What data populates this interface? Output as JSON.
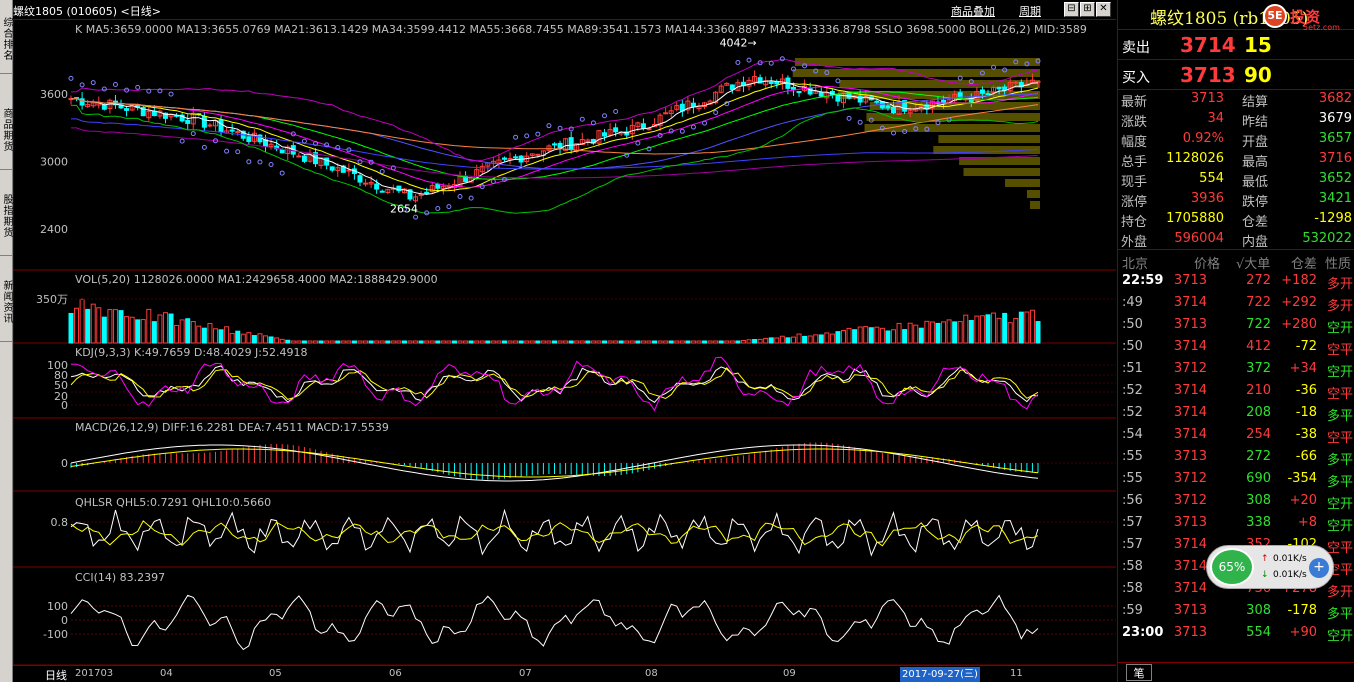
{
  "window": {
    "title": "螺纹1805 (010605) <日线>",
    "links": [
      "商品叠加",
      "周期"
    ],
    "nav_buttons": [
      "⊟",
      "⊞",
      "✕"
    ]
  },
  "left_tabs": [
    "综合排名",
    "商品期货",
    "股指期货",
    "新闻资讯"
  ],
  "indicators": {
    "main": "K  MA5:3659.0000  MA13:3655.0769  MA21:3613.1429  MA34:3599.4412  MA55:3668.7455  MA89:3541.1573  MA144:3360.8897  MA233:3336.8798  SSLO  3698.5000  BOLL(26,2)  MID:3589",
    "vol": "VOL(5,20)  1128026.0000  MA1:2429658.4000  MA2:1888429.9000",
    "kdj": "KDJ(9,3,3)  K:49.7659  D:48.4029  J:52.4918",
    "macd": "MACD(26,12,9)  DIFF:16.2281  DEA:7.4511  MACD:17.5539",
    "qhlsr": "QHLSR  QHL5:0.7291  QHL10:0.5660",
    "cci": "CCI(14)  83.2397"
  },
  "annotations": {
    "high": "4042→",
    "low": "2654"
  },
  "axis_labels": {
    "price": [
      "3600",
      "3000",
      "2400"
    ],
    "vol": [
      "350万"
    ],
    "kdj": [
      "100",
      "80",
      "50",
      "20",
      "0"
    ],
    "macd": [
      "0"
    ],
    "qhlsr": [
      "0.8"
    ],
    "cci": [
      "100",
      "0",
      "-100"
    ]
  },
  "date_axis": {
    "label": "日线",
    "ticks": [
      "201703",
      "04",
      "05",
      "06",
      "07",
      "08",
      "09",
      "11"
    ],
    "cursor": "2017-09-27(三)"
  },
  "quote": {
    "name": "螺纹1805 (rb1805)",
    "brand": "投资",
    "brand_sub": "5etz.com",
    "logo": "5E",
    "sell": {
      "label": "卖出",
      "price": "3714",
      "volume": "15"
    },
    "buy": {
      "label": "买入",
      "price": "3713",
      "volume": "90"
    },
    "stats": [
      {
        "l1": "最新",
        "v1": "3713",
        "c1": "#ff3b3b",
        "l2": "结算",
        "v2": "3682",
        "c2": "#ff3b3b"
      },
      {
        "l1": "涨跌",
        "v1": "34",
        "c1": "#ff3b3b",
        "l2": "昨结",
        "v2": "3679",
        "c2": "#ffffff"
      },
      {
        "l1": "幅度",
        "v1": "0.92%",
        "c1": "#ff3b3b",
        "l2": "开盘",
        "v2": "3657",
        "c2": "#2fe02f"
      },
      {
        "l1": "总手",
        "v1": "1128026",
        "c1": "#ffff00",
        "l2": "最高",
        "v2": "3716",
        "c2": "#ff3b3b"
      },
      {
        "l1": "现手",
        "v1": "554",
        "c1": "#ffff00",
        "l2": "最低",
        "v2": "3652",
        "c2": "#2fe02f"
      },
      {
        "l1": "涨停",
        "v1": "3936",
        "c1": "#ff3b3b",
        "l2": "跌停",
        "v2": "3421",
        "c2": "#2fe02f"
      },
      {
        "l1": "持仓",
        "v1": "1705880",
        "c1": "#ffff00",
        "l2": "仓差",
        "v2": "-1298",
        "c2": "#ffff00"
      },
      {
        "l1": "外盘",
        "v1": "596004",
        "c1": "#ff3b3b",
        "l2": "内盘",
        "v2": "532022",
        "c2": "#2fe02f"
      }
    ],
    "tick_headers": [
      "北京",
      "价格",
      "√大单",
      "仓差",
      "性质"
    ],
    "ticks": [
      {
        "time": "22:59",
        "full": true,
        "price": "3713",
        "vol": "272",
        "vol_c": "#ff3b3b",
        "oi": "+182",
        "oi_c": "#ff3b3b",
        "nat": "多开",
        "nat_c": "#ff3b3b"
      },
      {
        "time": ":49",
        "full": false,
        "price": "3714",
        "vol": "722",
        "vol_c": "#ff3b3b",
        "oi": "+292",
        "oi_c": "#ff3b3b",
        "nat": "多开",
        "nat_c": "#ff3b3b"
      },
      {
        "time": ":50",
        "full": false,
        "price": "3713",
        "vol": "722",
        "vol_c": "#2fe02f",
        "oi": "+280",
        "oi_c": "#ff3b3b",
        "nat": "空开",
        "nat_c": "#2fe02f"
      },
      {
        "time": ":50",
        "full": false,
        "price": "3714",
        "vol": "412",
        "vol_c": "#ff3b3b",
        "oi": "-72",
        "oi_c": "#ffff00",
        "nat": "空平",
        "nat_c": "#ff3b3b"
      },
      {
        "time": ":51",
        "full": false,
        "price": "3712",
        "vol": "372",
        "vol_c": "#2fe02f",
        "oi": "+34",
        "oi_c": "#ff3b3b",
        "nat": "空开",
        "nat_c": "#2fe02f"
      },
      {
        "time": ":52",
        "full": false,
        "price": "3714",
        "vol": "210",
        "vol_c": "#ff3b3b",
        "oi": "-36",
        "oi_c": "#ffff00",
        "nat": "空平",
        "nat_c": "#ff3b3b"
      },
      {
        "time": ":52",
        "full": false,
        "price": "3714",
        "vol": "208",
        "vol_c": "#2fe02f",
        "oi": "-18",
        "oi_c": "#ffff00",
        "nat": "多平",
        "nat_c": "#2fe02f"
      },
      {
        "time": ":54",
        "full": false,
        "price": "3714",
        "vol": "254",
        "vol_c": "#ff3b3b",
        "oi": "-38",
        "oi_c": "#ffff00",
        "nat": "空平",
        "nat_c": "#ff3b3b"
      },
      {
        "time": ":55",
        "full": false,
        "price": "3713",
        "vol": "272",
        "vol_c": "#2fe02f",
        "oi": "-66",
        "oi_c": "#ffff00",
        "nat": "多平",
        "nat_c": "#2fe02f"
      },
      {
        "time": ":55",
        "full": false,
        "price": "3712",
        "vol": "690",
        "vol_c": "#2fe02f",
        "oi": "-354",
        "oi_c": "#ffff00",
        "nat": "多平",
        "nat_c": "#2fe02f"
      },
      {
        "time": ":56",
        "full": false,
        "price": "3712",
        "vol": "308",
        "vol_c": "#2fe02f",
        "oi": "+20",
        "oi_c": "#ff3b3b",
        "nat": "空开",
        "nat_c": "#2fe02f"
      },
      {
        "time": ":57",
        "full": false,
        "price": "3713",
        "vol": "338",
        "vol_c": "#2fe02f",
        "oi": "+8",
        "oi_c": "#ff3b3b",
        "nat": "空开",
        "nat_c": "#2fe02f"
      },
      {
        "time": ":57",
        "full": false,
        "price": "3714",
        "vol": "352",
        "vol_c": "#ff3b3b",
        "oi": "-102",
        "oi_c": "#ffff00",
        "nat": "空平",
        "nat_c": "#ff3b3b"
      },
      {
        "time": ":58",
        "full": false,
        "price": "3714",
        "vol": "",
        "vol_c": "#ff3b3b",
        "oi": "",
        "oi_c": "#ffff00",
        "nat": "空平",
        "nat_c": "#ff3b3b"
      },
      {
        "time": ":58",
        "full": false,
        "price": "3714",
        "vol": "736",
        "vol_c": "#ff3b3b",
        "oi": "+278",
        "oi_c": "#ff3b3b",
        "nat": "多开",
        "nat_c": "#ff3b3b"
      },
      {
        "time": ":59",
        "full": false,
        "price": "3713",
        "vol": "308",
        "vol_c": "#2fe02f",
        "oi": "-178",
        "oi_c": "#ffff00",
        "nat": "多平",
        "nat_c": "#2fe02f"
      },
      {
        "time": "23:00",
        "full": true,
        "price": "3713",
        "vol": "554",
        "vol_c": "#2fe02f",
        "oi": "+90",
        "oi_c": "#ff3b3b",
        "nat": "空开",
        "nat_c": "#2fe02f"
      }
    ],
    "bottom_tab": "笔"
  },
  "speed_widget": {
    "percent": "65%",
    "up": "0.01K/s",
    "down": "0.01K/s",
    "plus": "+"
  },
  "colors": {
    "up": "#ff3b3b",
    "down": "#00ffff",
    "grid": "#800000"
  },
  "chart_data": {
    "type": "line",
    "dates": [
      "2017-03-01",
      "2017-04-03",
      "2017-05-02",
      "2017-06-01",
      "2017-07-03",
      "2017-08-01",
      "2017-09-01",
      "2017-10-09",
      "2017-11-01",
      "2017-11-17"
    ],
    "close": [
      3560,
      3380,
      3060,
      2680,
      3080,
      3300,
      3760,
      3480,
      3580,
      3713
    ],
    "price_labels": [
      3600,
      3000,
      2400
    ],
    "vol_label": "350万",
    "high_label": 4042,
    "low_label": 2654
  }
}
